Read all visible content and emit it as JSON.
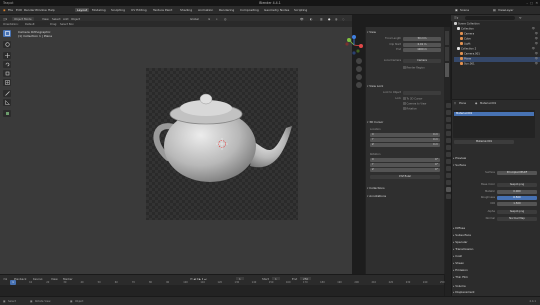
{
  "window": {
    "title": "Blender 4.4.1",
    "app_name": "Teapot"
  },
  "menu": {
    "items": [
      "File",
      "Edit",
      "Render",
      "Window",
      "Help"
    ],
    "workspaces": [
      "Layout",
      "Modeling",
      "Sculpting",
      "UV Editing",
      "Texture Paint",
      "Shading",
      "Animation",
      "Rendering",
      "Compositing",
      "Geometry Nodes",
      "Scripting"
    ],
    "active_workspace": "Layout",
    "scene_name": "Scene",
    "view_layer": "ViewLayer"
  },
  "header3d": {
    "mode": "Object Mode",
    "view": "View",
    "select": "Select",
    "add": "Add",
    "object": "Object",
    "transform": "Global",
    "orientation_label": "Orientation:",
    "orientation_value": "Default",
    "drag_label": "Drag:",
    "drag_value": "Select Box"
  },
  "viewport": {
    "info_line1": "Camera Orthographic",
    "info_line2": "(1) Collection 1 | Plane"
  },
  "npanel": {
    "view_section": "View",
    "focal_label": "Focal Length",
    "focal_value": "50 mm",
    "clip_start_label": "Clip Start",
    "clip_start_value": "0.01 m",
    "clip_end_label": "End",
    "clip_end_value": "1000 m",
    "local_camera_label": "Local Camera",
    "local_camera_value": "Camera",
    "render_region": "Render Region",
    "view_lock_section": "View Lock",
    "lock_to_object_label": "Lock to Object",
    "lock_label": "Lock",
    "lock_to_3d_cursor": "To 3D Cursor",
    "camera_to_view": "Camera to View",
    "rotation": "Rotation",
    "cursor_section": "3D Cursor",
    "location_label": "Location",
    "loc_x_label": "X",
    "loc_x": "0 m",
    "loc_y_label": "Y",
    "loc_y": "0 m",
    "loc_z_label": "Z",
    "loc_z": "0 m",
    "rotation_label": "Rotation",
    "rot_x_label": "X",
    "rot_x": "0°",
    "rot_y_label": "Y",
    "rot_y": "0°",
    "rot_z_label": "Z",
    "rot_z": "0°",
    "rotation_mode": "XYZ Euler",
    "collections_section": "Collections",
    "annotations_section": "Annotations",
    "tabs": [
      "Item",
      "Tool",
      "View"
    ]
  },
  "timeline": {
    "playback": "Playback",
    "keying": "Keying",
    "view": "View",
    "marker": "Marker",
    "current_frame": "1",
    "start_label": "Start",
    "start": "1",
    "end_label": "End",
    "end": "250",
    "ticks": [
      "1",
      "10",
      "20",
      "30",
      "40",
      "50",
      "60",
      "70",
      "80",
      "90",
      "100",
      "110",
      "120",
      "130",
      "140",
      "150",
      "160",
      "170",
      "180",
      "190",
      "200",
      "210",
      "220",
      "230",
      "240",
      "250"
    ]
  },
  "status": {
    "select": "Select",
    "rotate": "Rotate View",
    "object": "Object",
    "version": "4.4.1"
  },
  "outliner": {
    "search_placeholder": "",
    "scene_collection": "Scene Collection",
    "items": [
      {
        "name": "Collection",
        "color": "#e0e0e0",
        "indent": 1
      },
      {
        "name": "Camera",
        "color": "#e09050",
        "indent": 2
      },
      {
        "name": "Cube",
        "color": "#e09050",
        "indent": 2
      },
      {
        "name": "Light",
        "color": "#e09050",
        "indent": 2
      },
      {
        "name": "Collection 2",
        "color": "#e0e0e0",
        "indent": 1
      },
      {
        "name": "Camera.001",
        "color": "#e09050",
        "indent": 2
      },
      {
        "name": "Plane",
        "color": "#e09050",
        "indent": 2
      },
      {
        "name": "Sun.001",
        "color": "#e09050",
        "indent": 2
      }
    ]
  },
  "properties": {
    "object_name": "Plane",
    "material_name": "Material.001",
    "slot_name": "Material.001",
    "sections": {
      "preview": "Preview",
      "surface": "Surface",
      "surface_label": "Surface",
      "surface_value": "Principled BSDF",
      "base_color_label": "Base Color",
      "base_color_value": "teapot.png",
      "metallic_label": "Metallic",
      "metallic_value": "0.000",
      "roughness_label": "Roughness",
      "roughness_value": "0.500",
      "ior_label": "IOR",
      "ior_value": "1.500",
      "alpha_label": "Alpha",
      "alpha_value": "teapot.png",
      "normal_label": "Normal",
      "normal_value": "Normal Map",
      "diffuse": "Diffuse",
      "subsurface": "Subsurface",
      "specular": "Specular",
      "transmission": "Transmission",
      "coat": "Coat",
      "sheen": "Sheen",
      "emission": "Emission",
      "thin_film": "Thin Film",
      "volume": "Volume",
      "displacement": "Displacement"
    }
  },
  "colors": {
    "accent": "#4772b3",
    "teapot": "#cfcfcf",
    "cursor": "#e04040"
  }
}
